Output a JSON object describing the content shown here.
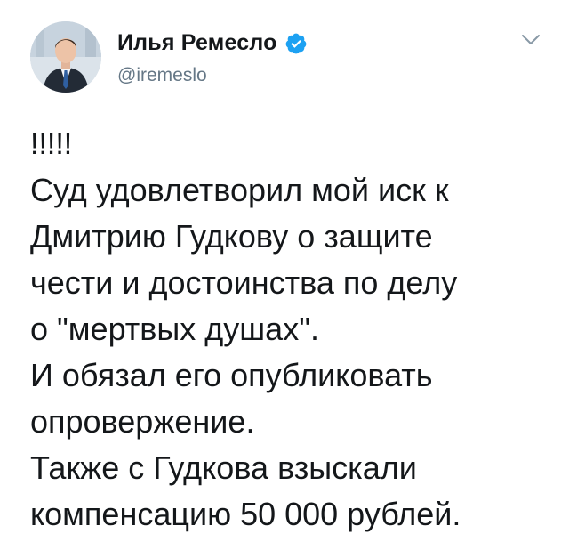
{
  "author": {
    "display_name": "Илья Ремесло",
    "handle": "@iremeslo",
    "verified_icon": "verified-badge-icon",
    "avatar_icon": "avatar-photo"
  },
  "menu": {
    "caret_icon": "chevron-down-icon"
  },
  "tweet": {
    "lines": [
      "!!!!!",
      "Суд удовлетворил мой иск к",
      "Дмитрию Гудкову о защите",
      "чести и достоинства по делу",
      "о \"мертвых душах\".",
      "И обязал его опубликовать",
      "опровержение.",
      "Также с Гудкова взыскали",
      "компенсацию 50 000 рублей."
    ]
  },
  "colors": {
    "text": "#14171a",
    "secondary": "#657786",
    "verified_blue": "#1da1f2",
    "caret": "#8899a6"
  }
}
